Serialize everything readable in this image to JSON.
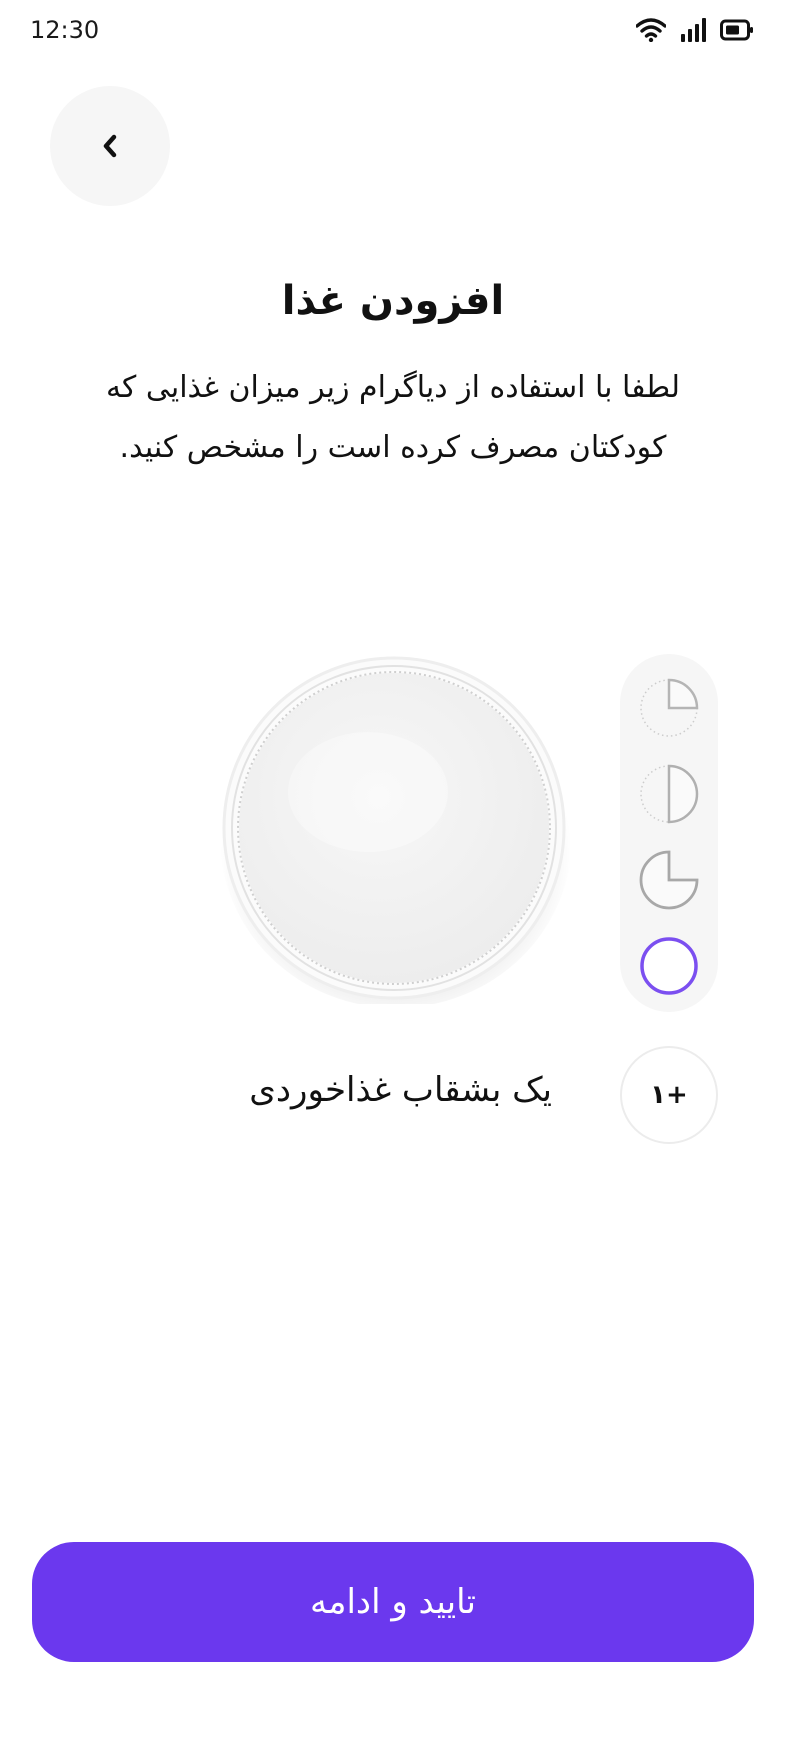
{
  "status_bar": {
    "time": "12:30"
  },
  "header": {
    "title": "افزودن غذا"
  },
  "instructions": "لطفا با استفاده از دیاگرام زیر میزان غذایی که کودکتان مصرف کرده است را مشخص کنید.",
  "portion_selector": {
    "options": [
      "quarter",
      "half",
      "three-quarters",
      "full"
    ],
    "selected": "full",
    "accent_color": "#7b4ff0"
  },
  "quantity": {
    "increment_label": "+۱",
    "size_label": "یک بشقاب غذاخوردی"
  },
  "footer": {
    "confirm_label": "تایید و ادامه",
    "button_color": "#6b38ee"
  }
}
